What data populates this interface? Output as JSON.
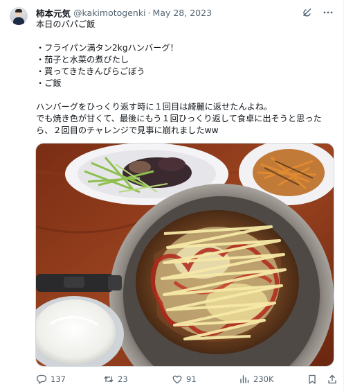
{
  "tweet": {
    "author_name": "柿本元気",
    "handle": "@kakimotogenki",
    "separator": "·",
    "date": "May 28, 2023",
    "lines": [
      "本日のパパご飯",
      "",
      "・フライパン満タン2kgハンバーグ！",
      "・茄子と水菜の煮びたし",
      "・買ってきたきんぴらごぼう",
      "・ご飯",
      "",
      "ハンバーグをひっくり返す時に１回目は綺麗に返せたんよね。",
      "でも焼き色が甘くて、最後にもう１回ひっくり返して食卓に出そうと思った",
      "ら、２回目のチャレンジで見事に崩れましたww"
    ]
  },
  "stats": {
    "replies": "137",
    "retweets": "23",
    "likes": "91",
    "views": "230K"
  },
  "icons": {
    "top": [
      "grok-icon",
      "more-icon"
    ],
    "actions": [
      "reply-icon",
      "retweet-icon",
      "like-icon",
      "views-icon",
      "bookmark-icon",
      "share-icon"
    ]
  },
  "colors": {
    "text": "#0f1419",
    "secondary": "#536471",
    "border": "#cfd9de"
  }
}
